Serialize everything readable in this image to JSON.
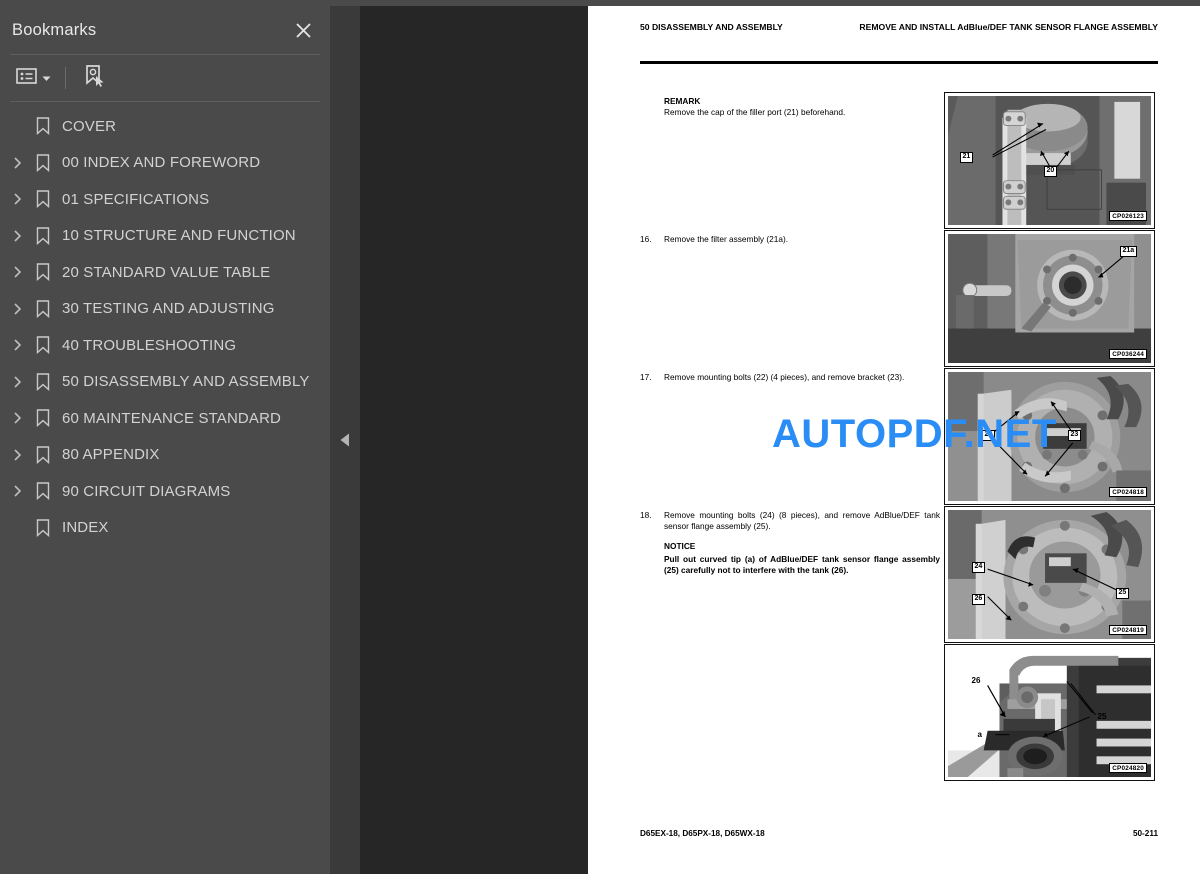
{
  "sidebar": {
    "title": "Bookmarks",
    "close_icon": "close-icon",
    "toolbar": {
      "options_icon": "list-options-icon",
      "dropdown_icon": "chevron-down-icon",
      "new_bookmark_icon": "new-bookmark-cursor-icon"
    },
    "items": [
      {
        "label": "COVER",
        "expandable": false
      },
      {
        "label": "00 INDEX AND FOREWORD",
        "expandable": true
      },
      {
        "label": "01 SPECIFICATIONS",
        "expandable": true
      },
      {
        "label": "10 STRUCTURE AND FUNCTION",
        "expandable": true
      },
      {
        "label": "20 STANDARD VALUE TABLE",
        "expandable": true
      },
      {
        "label": "30 TESTING AND ADJUSTING",
        "expandable": true
      },
      {
        "label": "40 TROUBLESHOOTING",
        "expandable": true
      },
      {
        "label": "50 DISASSEMBLY AND ASSEMBLY",
        "expandable": true
      },
      {
        "label": "60 MAINTENANCE STANDARD",
        "expandable": true
      },
      {
        "label": "80 APPENDIX",
        "expandable": true
      },
      {
        "label": "90 CIRCUIT DIAGRAMS",
        "expandable": true
      },
      {
        "label": "INDEX",
        "expandable": false
      }
    ]
  },
  "viewer": {
    "collapse_handle_icon": "collapse-left-triangle-icon",
    "watermark": "AUTOPDF.NET",
    "watermark_color": "#2a8cf5"
  },
  "document": {
    "header_left": "50 DISASSEMBLY AND ASSEMBLY",
    "header_right": "REMOVE AND INSTALL AdBlue/DEF TANK SENSOR FLANGE ASSEMBLY",
    "footer_left": "D65EX-18, D65PX-18, D65WX-18",
    "footer_right": "50-211",
    "blocks": [
      {
        "number": "",
        "title": "REMARK",
        "text": "Remove the cap of the filler port (21) beforehand.",
        "notice_title": "",
        "notice_text": ""
      },
      {
        "number": "16.",
        "title": "",
        "text": "Remove the filter assembly (21a).",
        "notice_title": "",
        "notice_text": ""
      },
      {
        "number": "17.",
        "title": "",
        "text": "Remove mounting bolts (22) (4 pieces), and remove bracket (23).",
        "notice_title": "",
        "notice_text": ""
      },
      {
        "number": "18.",
        "title": "",
        "text": "Remove mounting bolts (24) (8 pieces), and remove AdBlue/DEF tank sensor flange assembly (25).",
        "notice_title": "NOTICE",
        "notice_text": "Pull out curved tip (a) of AdBlue/DEF tank sensor flange assembly (25) carefully not to interfere with the tank (26)."
      }
    ],
    "figures": [
      {
        "id": "CP026123",
        "callouts": [
          "21",
          "20"
        ]
      },
      {
        "id": "CP036244",
        "callouts": [
          "21a"
        ]
      },
      {
        "id": "CP024818",
        "callouts": [
          "22",
          "23"
        ]
      },
      {
        "id": "CP024819",
        "callouts": [
          "24",
          "26",
          "25"
        ]
      },
      {
        "id": "CP024820",
        "callouts": [
          "26",
          "a",
          "25"
        ]
      }
    ]
  }
}
